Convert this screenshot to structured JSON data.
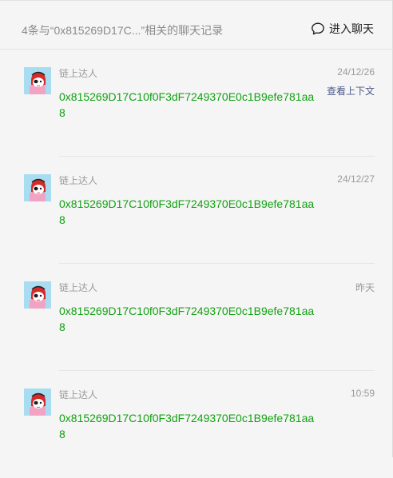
{
  "header": {
    "title": "4条与“0x815269D17C...”相关的聊天记录",
    "enter_chat_label": "进入聊天",
    "enter_chat_icon": "chat-bubble-icon"
  },
  "records": [
    {
      "sender": "链上达人",
      "time": "24/12/26",
      "context_link": "查看上下文",
      "message": "0x815269D17C10f0F3dF7249370E0c1B9efe781aa8"
    },
    {
      "sender": "链上达人",
      "time": "24/12/27",
      "message": "0x815269D17C10f0F3dF7249370E0c1B9efe781aa8"
    },
    {
      "sender": "链上达人",
      "time": "昨天",
      "message": "0x815269D17C10f0F3dF7249370E0c1B9efe781aa8"
    },
    {
      "sender": "链上达人",
      "time": "10:59",
      "message": "0x815269D17C10f0F3dF7249370E0c1B9efe781aa8"
    }
  ],
  "colors": {
    "background": "#f5f5f5",
    "message_green": "#13a113",
    "muted_gray": "#9a9a9a",
    "link_blue": "#4a5a8a",
    "avatar_bg": "#a8dcf0"
  }
}
